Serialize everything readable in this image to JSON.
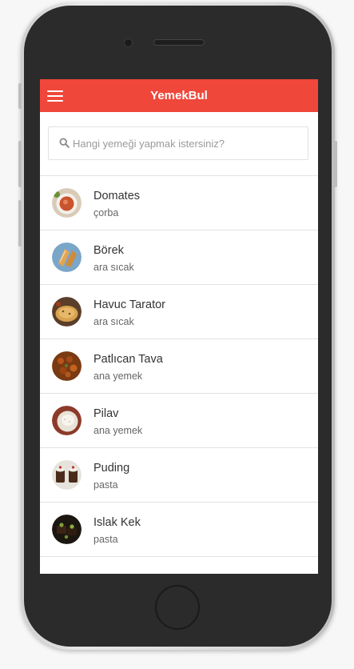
{
  "header": {
    "title": "YemekBul",
    "bg_color": "#ef473a"
  },
  "search": {
    "placeholder": "Hangi yemeği yapmak istersiniz?",
    "value": ""
  },
  "recipes": [
    {
      "name": "Domates",
      "category": "çorba",
      "image_icon": "tomato-soup-thumbnail"
    },
    {
      "name": "Börek",
      "category": "ara sıcak",
      "image_icon": "borek-thumbnail"
    },
    {
      "name": "Havuc Tarator",
      "category": "ara sıcak",
      "image_icon": "carrot-tarator-thumbnail"
    },
    {
      "name": "Patlıcan Tava",
      "category": "ana yemek",
      "image_icon": "fried-eggplant-thumbnail"
    },
    {
      "name": "Pilav",
      "category": "ana yemek",
      "image_icon": "rice-pilaf-thumbnail"
    },
    {
      "name": "Puding",
      "category": "pasta",
      "image_icon": "pudding-thumbnail"
    },
    {
      "name": "Islak Kek",
      "category": "pasta",
      "image_icon": "wet-cake-thumbnail"
    }
  ]
}
